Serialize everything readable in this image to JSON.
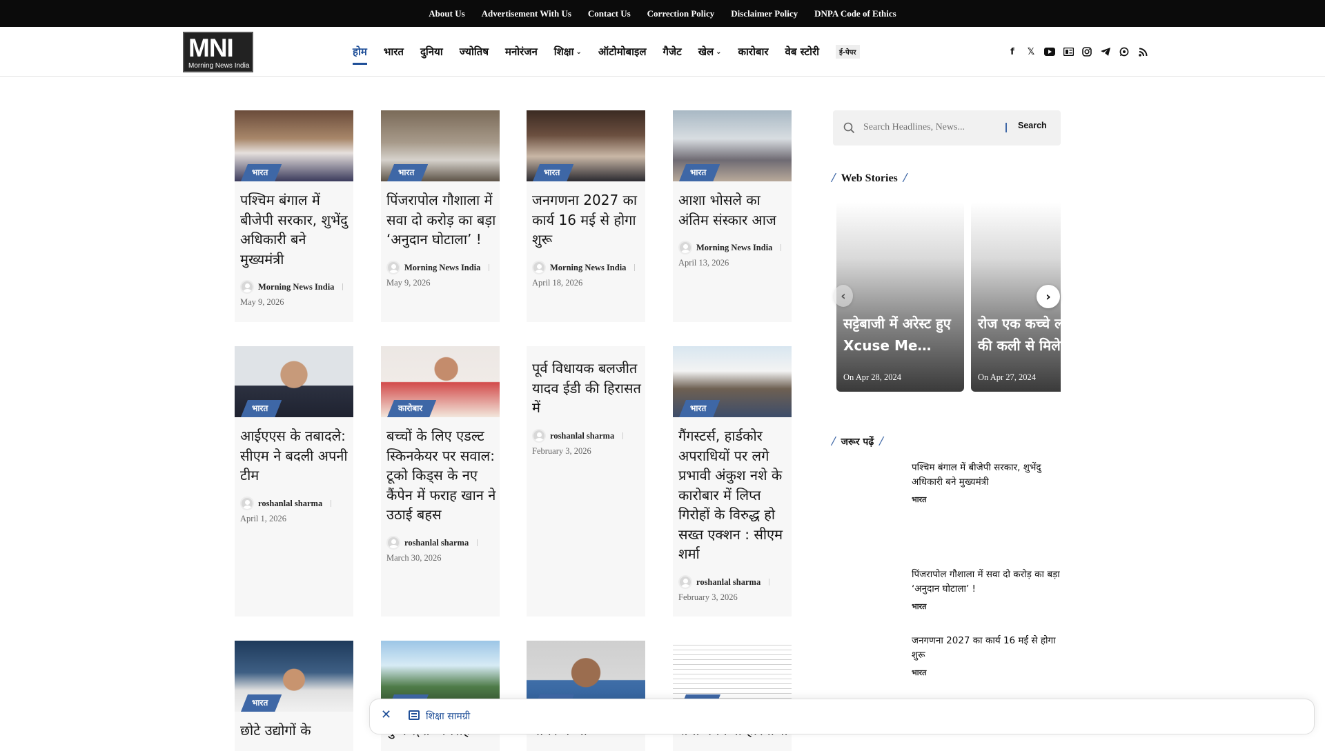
{
  "topbar": {
    "links": [
      "About Us",
      "Advertisement With Us",
      "Contact Us",
      "Correction Policy",
      "Disclaimer Policy",
      "DNPA Code of Ethics"
    ]
  },
  "header": {
    "logo_mark": "MNI",
    "logo_sub": "Morning News India",
    "nav": [
      {
        "label": "होम",
        "active": true
      },
      {
        "label": "भारत"
      },
      {
        "label": "दुनिया"
      },
      {
        "label": "ज्योतिष"
      },
      {
        "label": "मनोरंजन"
      },
      {
        "label": "शिक्षा",
        "dropdown": true
      },
      {
        "label": "ऑटोमोबाइल"
      },
      {
        "label": "गैजेट"
      },
      {
        "label": "खेल",
        "dropdown": true
      },
      {
        "label": "कारोबार"
      },
      {
        "label": "वेब स्टोरी"
      }
    ],
    "epaper": "ई-पेपर",
    "socials": [
      "facebook-icon",
      "x-icon",
      "youtube-icon",
      "dailyhunt-icon",
      "instagram-icon",
      "telegram-icon",
      "whatsapp-icon",
      "rss-icon"
    ]
  },
  "cards": [
    {
      "category": "भारत",
      "title": "पश्चिम बंगाल में बीजेपी सरकार, शुभेंदु अधिकारी बने मुख्यमंत्री",
      "author": "Morning News India",
      "date": "May 9, 2026",
      "img": "rally"
    },
    {
      "category": "भारत",
      "title": "पिंजरापोल गौशाला में सवा दो करोड़ का बड़ा ‘अनुदान घोटाला’ !",
      "author": "Morning News India",
      "date": "May 9, 2026",
      "img": "cows"
    },
    {
      "category": "भारत",
      "title": "जनगणना 2027 का कार्य 16 मई से होगा शुरू",
      "author": "Morning News India",
      "date": "April 18, 2026",
      "img": "meeting"
    },
    {
      "category": "भारत",
      "title": "आशा भोसले का अंतिम संस्कार आज",
      "author": "Morning News India",
      "date": "April 13, 2026",
      "img": "funeral"
    },
    {
      "category": "भारत",
      "title": "आईएएस के तबादले: सीएम ने बदली अपनी टीम",
      "author": "roshanlal sharma",
      "date": "April 1, 2026",
      "img": "portrait"
    },
    {
      "category": "कारोबार",
      "title": "बच्चों के लिए एडल्ट स्किनकेयर पर सवाल: टूको किड्स के नए कैंपेन में फराह खान ने उठाई बहस",
      "author": "roshanlal sharma",
      "date": "March 30, 2026",
      "img": "woman"
    },
    {
      "category": "",
      "title": "पूर्व विधायक बलजीत यादव ईडी की हिरासत में",
      "author": "roshanlal sharma",
      "date": "February 3, 2026",
      "img": ""
    },
    {
      "category": "भारत",
      "title": "गैंगस्टर्स, हार्डकोर अपराधियों पर लगे प्रभावी अंकुश नशे के कारोबार में लिप्त गिरोहों के विरुद्ध हो सख्त एक्शन : सीएम शर्मा",
      "author": "roshanlal sharma",
      "date": "February 3, 2026",
      "img": "conference"
    },
    {
      "category": "भारत",
      "title": "छोटे उद्योगों के",
      "author": "",
      "date": "",
      "img": "cm"
    },
    {
      "category": "",
      "title": "पुष्कर(राज्य सिंह",
      "author": "",
      "date": "",
      "img": "statue"
    },
    {
      "category": "",
      "title": "नीयर में भी",
      "author": "",
      "date": "",
      "img": "man"
    },
    {
      "category": "",
      "title": "शर्मा ने किया हरियाणा",
      "author": "",
      "date": "",
      "img": "press"
    }
  ],
  "sidebar": {
    "search_placeholder": "Search Headlines, News...",
    "search_button": "Search",
    "web_stories_heading": "Web Stories",
    "stories": [
      {
        "title": "सट्टेबाजी में अरेस्ट हुए Xcuse Me…",
        "date": "On Apr 28, 2024"
      },
      {
        "title": "रोज एक कच्चे ल की कली से मिले",
        "date": "On Apr 27, 2024"
      }
    ],
    "must_read_heading": "जरूर पढ़ें",
    "must_read": [
      {
        "title": "पश्चिम बंगाल में बीजेपी सरकार, शुभेंदु अधिकारी बने मुख्यमंत्री",
        "category": "भारत"
      },
      {
        "title": "पिंजरापोल गौशाला में सवा दो करोड़ का बड़ा ‘अनुदान घोटाला’ !",
        "category": "भारत"
      },
      {
        "title": "जनगणना 2027 का कार्य 16 मई से होगा शुरू",
        "category": "भारत"
      }
    ]
  },
  "floatbar": {
    "label": "शिक्षा सामग्री"
  }
}
